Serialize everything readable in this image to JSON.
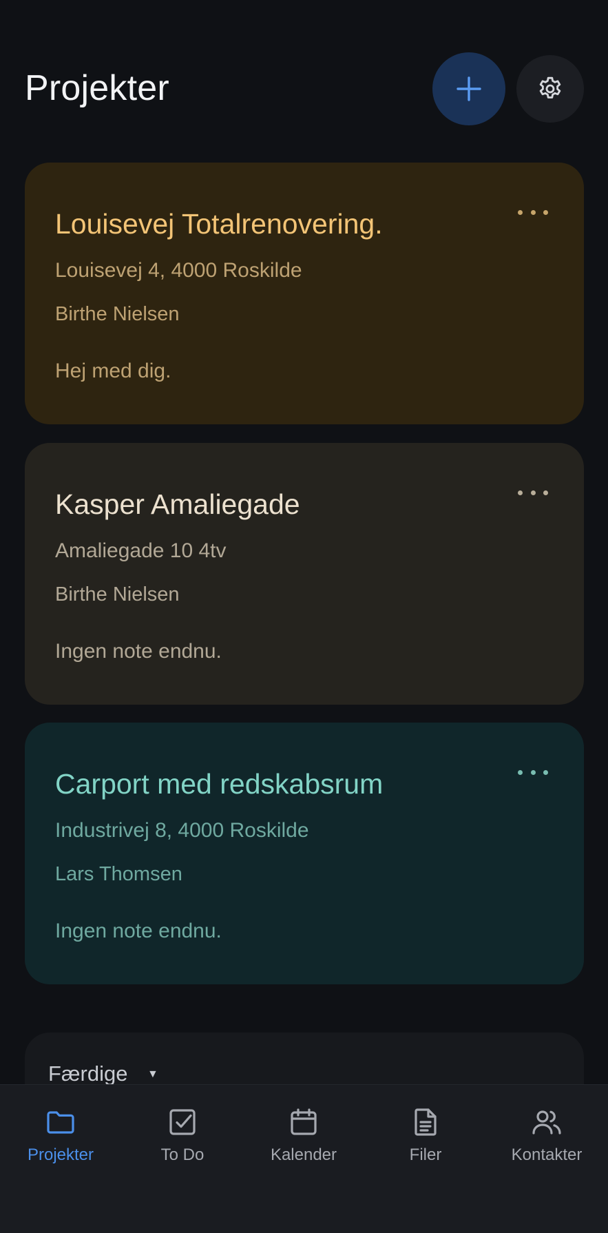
{
  "header": {
    "title": "Projekter"
  },
  "projects": [
    {
      "title": "Louisevej Totalrenovering.",
      "address": "Louisevej 4, 4000 Roskilde",
      "person": "Birthe Nielsen",
      "note": "Hej med dig.",
      "color": "#2e2410"
    },
    {
      "title": "Kasper Amaliegade",
      "address": "Amaliegade 10 4tv",
      "person": "Birthe Nielsen",
      "note": "Ingen note endnu.",
      "color": "#25231e"
    },
    {
      "title": "Carport med redskabsrum",
      "address": "Industrivej 8, 4000 Roskilde",
      "person": "Lars Thomsen",
      "note": "Ingen note endnu.",
      "color": "#10262a"
    }
  ],
  "done_section": {
    "label": "Færdige"
  },
  "tabbar": {
    "tabs": [
      {
        "label": "Projekter",
        "icon": "folder-icon",
        "active": true
      },
      {
        "label": "To Do",
        "icon": "checkbox-icon",
        "active": false
      },
      {
        "label": "Kalender",
        "icon": "calendar-icon",
        "active": false
      },
      {
        "label": "Filer",
        "icon": "file-icon",
        "active": false
      },
      {
        "label": "Kontakter",
        "icon": "contacts-icon",
        "active": false
      }
    ]
  },
  "colors": {
    "background": "#0f1115",
    "accent": "#4b8fea",
    "add_button": "#1a3257"
  }
}
